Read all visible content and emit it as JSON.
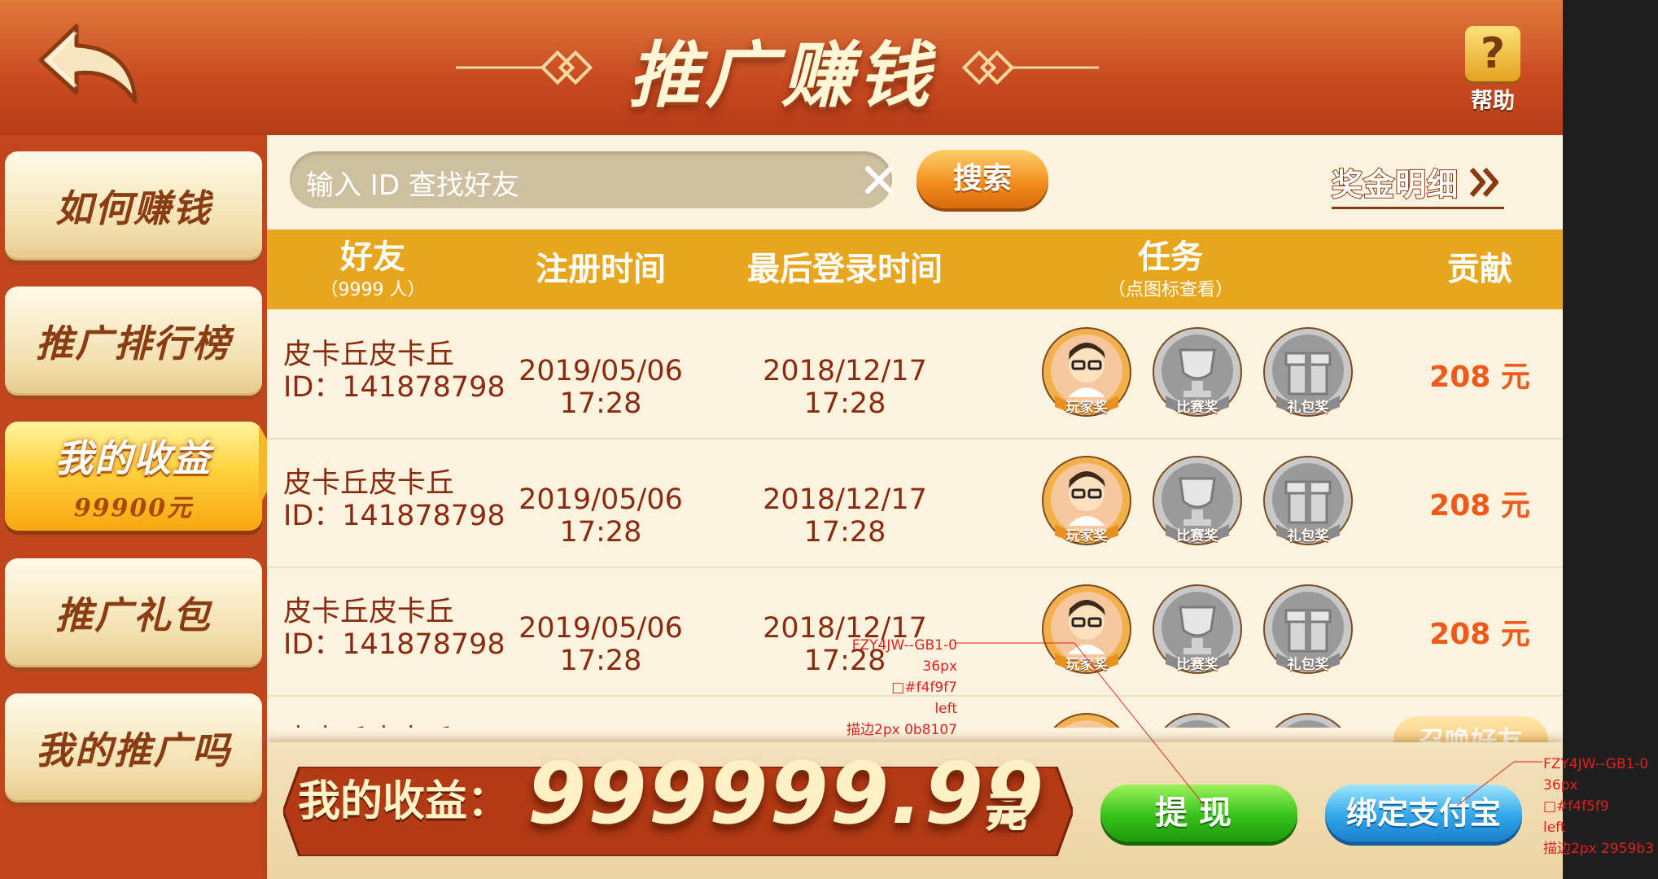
{
  "header": {
    "title": "推广赚钱",
    "help_label": "帮助",
    "help_symbol": "?"
  },
  "sidebar": {
    "items": [
      {
        "label": "如何赚钱"
      },
      {
        "label": "推广排行榜"
      },
      {
        "label": "我的收益",
        "sub": "99900元",
        "active": true
      },
      {
        "label": "推广礼包"
      },
      {
        "label": "我的推广吗"
      }
    ]
  },
  "search": {
    "placeholder": "输入 ID 查找好友",
    "button_label": "搜索"
  },
  "bonus_detail_label": "奖金明细",
  "table": {
    "headers": {
      "friend": "好友",
      "friend_count": "（9999 人）",
      "register_time": "注册时间",
      "last_login": "最后登录时间",
      "task": "任务",
      "task_hint": "（点图标查看）",
      "contribution": "贡献"
    },
    "rows": [
      {
        "name": "皮卡丘皮卡丘",
        "id": "ID：141878798",
        "register": "2019/05/06 17:28",
        "last_login": "2018/12/17 17:28",
        "contribution": "208 元"
      },
      {
        "name": "皮卡丘皮卡丘",
        "id": "ID：141878798",
        "register": "2019/05/06 17:28",
        "last_login": "2018/12/17 17:28",
        "contribution": "208 元"
      },
      {
        "name": "皮卡丘皮卡丘",
        "id": "ID：141878798",
        "register": "2019/05/06 17:28",
        "last_login": "2018/12/17 17:28",
        "contribution": "208 元"
      },
      {
        "name": "皮卡丘皮卡丘",
        "id": "",
        "register": "",
        "last_login": "",
        "contribution": ""
      }
    ],
    "badges": {
      "player": "玩家奖",
      "match": "比赛奖",
      "gift": "礼包奖"
    }
  },
  "invite_button": "召唤好友",
  "bottom": {
    "earnings_label": "我的收益：",
    "earnings_value": "999999.99",
    "earnings_unit": "元",
    "withdraw_label": "提现",
    "alipay_label": "绑定支付宝"
  },
  "annotations": [
    {
      "lines": [
        "FZY4JW--GB1-0",
        "36px",
        "□#f4f9f7",
        "left",
        "描边2px  0b8107"
      ]
    },
    {
      "lines": [
        "FZY4JW--GB1-0",
        "36px",
        "□#f4f5f9",
        "left",
        "描边2px 2959b3"
      ]
    }
  ],
  "colors": {
    "header": "#c84a20",
    "table_header": "#e8a51e",
    "row_text": "#8a2a10",
    "contribution": "#ef5a1a",
    "withdraw": "#36c11a",
    "alipay": "#32a6e8",
    "annotation": "#e02020"
  }
}
